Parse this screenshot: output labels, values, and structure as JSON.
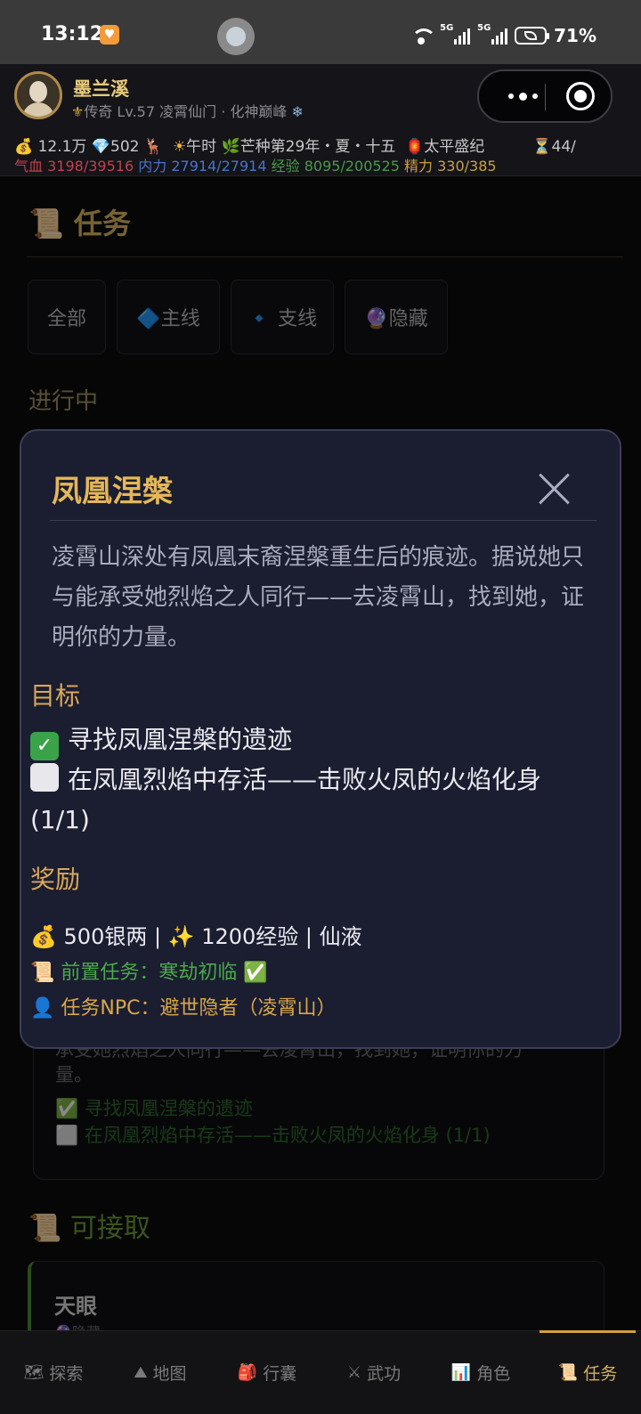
{
  "status_bar": {
    "time": "13:12",
    "net1": "6",
    "net2": "5G",
    "net3": "5G",
    "battery": "71%"
  },
  "player": {
    "name": "墨兰溪",
    "rank_line": "传奇 Lv.57 凌霄仙门 · 化神巅峰",
    "fleur": "⚜",
    "snow": "❄"
  },
  "stats": {
    "money": "12.1万",
    "gems": "502",
    "deer": "🦌",
    "time_of_day": "午时",
    "season": "芒种第29年・夏・十五",
    "era": "太平盛纪",
    "hourglass": "44/",
    "hp_label": "气血",
    "hp": "3198/39516",
    "mp_label": "内力",
    "mp": "27914/27914",
    "exp_label": "经验",
    "exp": "8095/200525",
    "stamina_label": "精力",
    "stamina": "330/385"
  },
  "page": {
    "title": "📜 任务",
    "tabs": [
      "全部",
      "🔷主线",
      "🔹 支线",
      "🔮隐藏"
    ],
    "in_progress": "进行中",
    "bg_card": {
      "desc_line1": "承受她烈焰之人同行——去凌霄山，找到她，证明你的力",
      "desc_line2": "量。",
      "obj1": "✅ 寻找凤凰涅槃的遗迹",
      "obj2": "⬜ 在凤凰烈焰中存活——击败火凤的火焰化身 (1/1)"
    },
    "available_title": "📜 可接取",
    "available_quest": {
      "title": "天眼",
      "sub": "🔮隐藏"
    }
  },
  "modal": {
    "title": "凤凰涅槃",
    "description": "凌霄山深处有凤凰末裔涅槃重生后的痕迹。据说她只与能承受她烈焰之人同行——去凌霄山，找到她，证明你的力量。",
    "objectives_heading": "目标",
    "objective1": "寻找凤凰涅槃的遗迹",
    "objective2": "在凤凰烈焰中存活——击败火凤的火焰化身 (1/1)",
    "rewards_heading": "奖励",
    "reward_line": "500银两 | ✨ 1200经验 | 仙液",
    "prerequisite": "前置任务：寒劫初临 ✅",
    "npc": "任务NPC：避世隐者（凌霄山）"
  },
  "bottom_nav": [
    {
      "icon": "🗺",
      "label": "探索"
    },
    {
      "icon": "⛰",
      "label": "地图"
    },
    {
      "icon": "🎒",
      "label": "行囊"
    },
    {
      "icon": "⚔",
      "label": "武功"
    },
    {
      "icon": "📊",
      "label": "角色"
    },
    {
      "icon": "📜",
      "label": "任务"
    }
  ]
}
